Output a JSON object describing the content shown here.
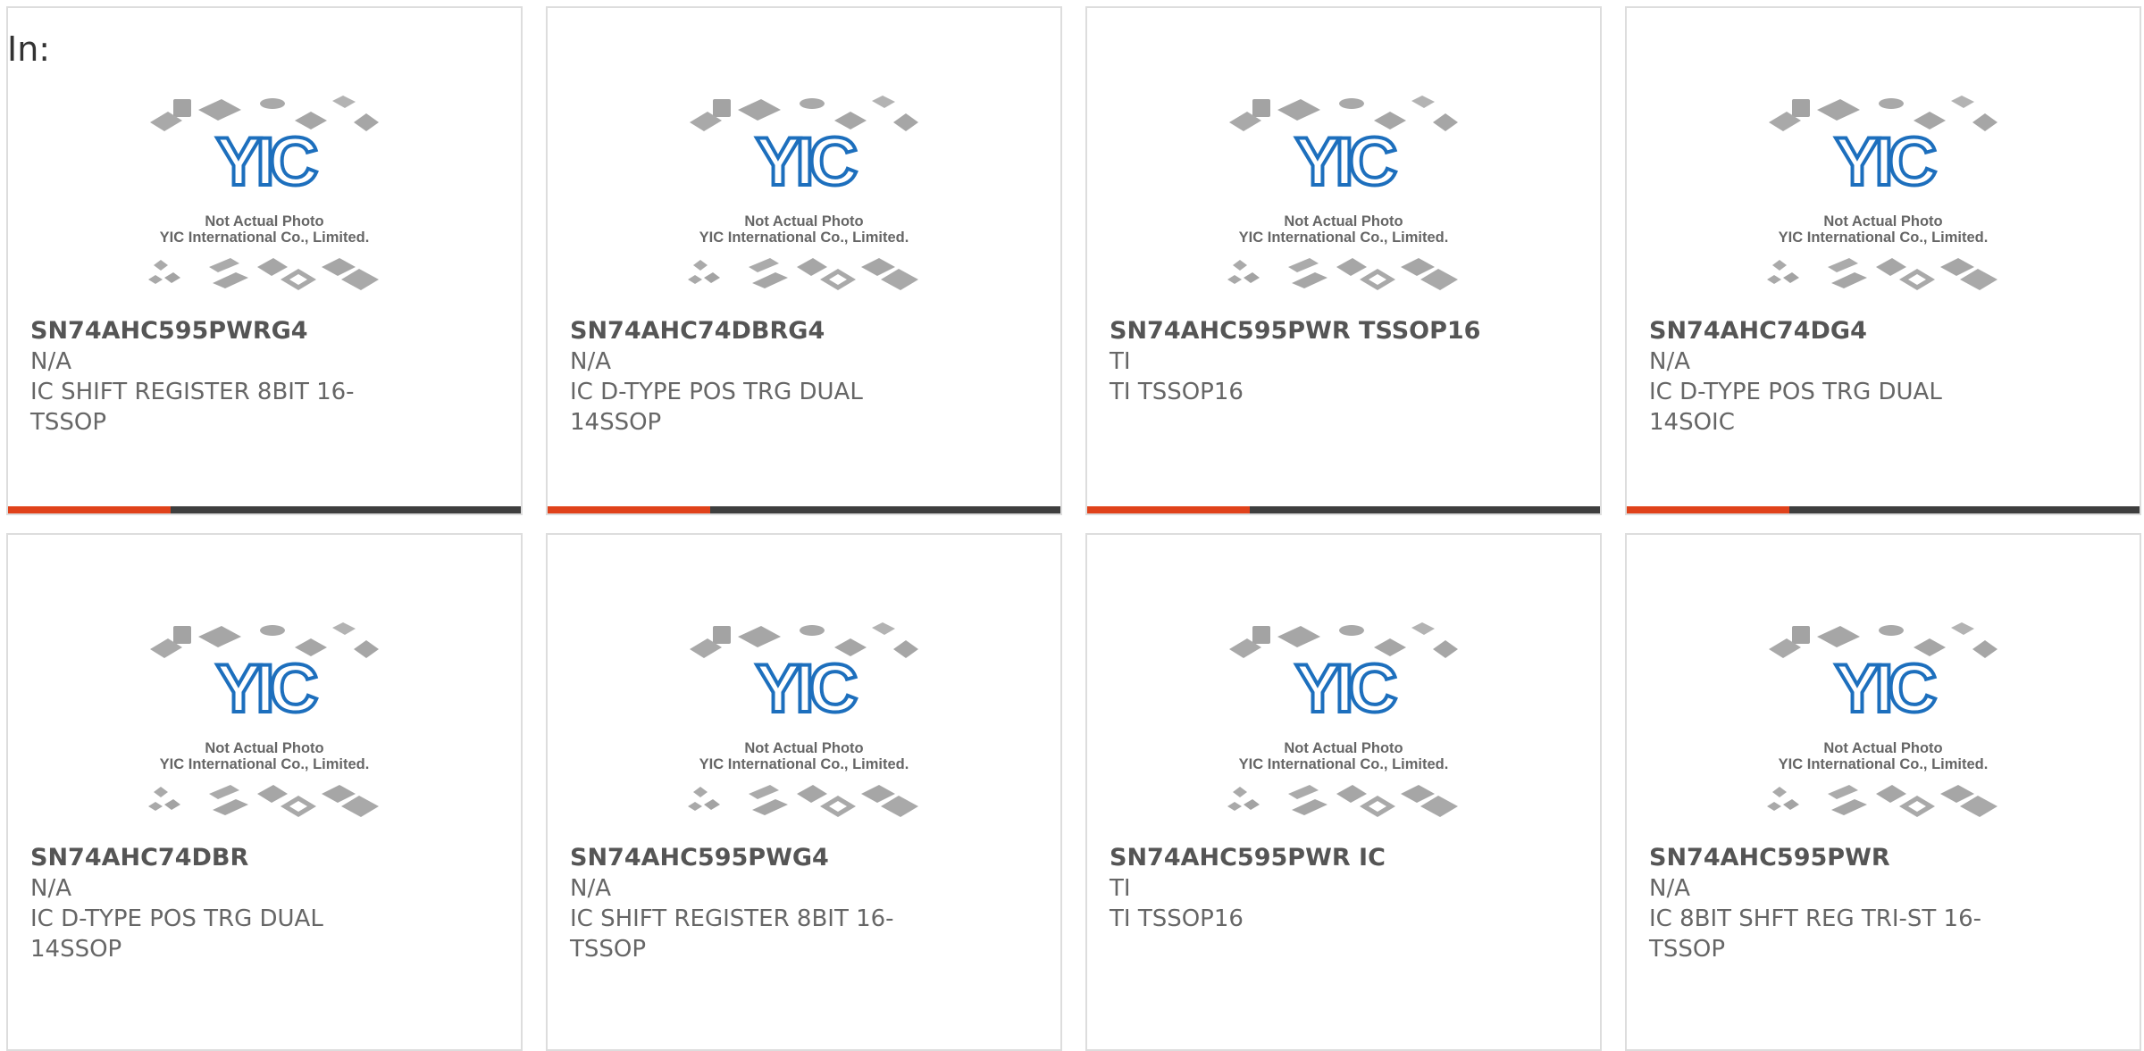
{
  "header": {
    "in_label": "In:"
  },
  "photo": {
    "line1": "Not Actual Photo",
    "line2": "YIC International Co., Limited.",
    "logo_text": "YIC",
    "icon": "placeholder-chip-photo-icon"
  },
  "colors": {
    "accent": "#e0421b",
    "bar_dark": "#3e3e3e",
    "logo_blue": "#1d6fbd",
    "card_border": "#dddddd",
    "text": "#666666"
  },
  "products": [
    {
      "part_no": "SN74AHC595PWRG4",
      "brand": "N/A",
      "description": "IC SHIFT REGISTER 8BIT 16-TSSOP"
    },
    {
      "part_no": "SN74AHC74DBRG4",
      "brand": "N/A",
      "description": "IC D-TYPE POS TRG DUAL 14SSOP"
    },
    {
      "part_no": "SN74AHC595PWR TSSOP16",
      "brand": "TI",
      "description": "TI TSSOP16"
    },
    {
      "part_no": "SN74AHC74DG4",
      "brand": "N/A",
      "description": "IC D-TYPE POS TRG DUAL 14SOIC"
    },
    {
      "part_no": "SN74AHC74DBR",
      "brand": "N/A",
      "description": "IC D-TYPE POS TRG DUAL 14SSOP"
    },
    {
      "part_no": "SN74AHC595PWG4",
      "brand": "N/A",
      "description": "IC SHIFT REGISTER 8BIT 16-TSSOP"
    },
    {
      "part_no": "SN74AHC595PWR IC",
      "brand": "TI",
      "description": "TI TSSOP16"
    },
    {
      "part_no": "SN74AHC595PWR",
      "brand": "N/A",
      "description": "IC 8BIT SHFT REG TRI-ST 16-TSSOP"
    }
  ]
}
